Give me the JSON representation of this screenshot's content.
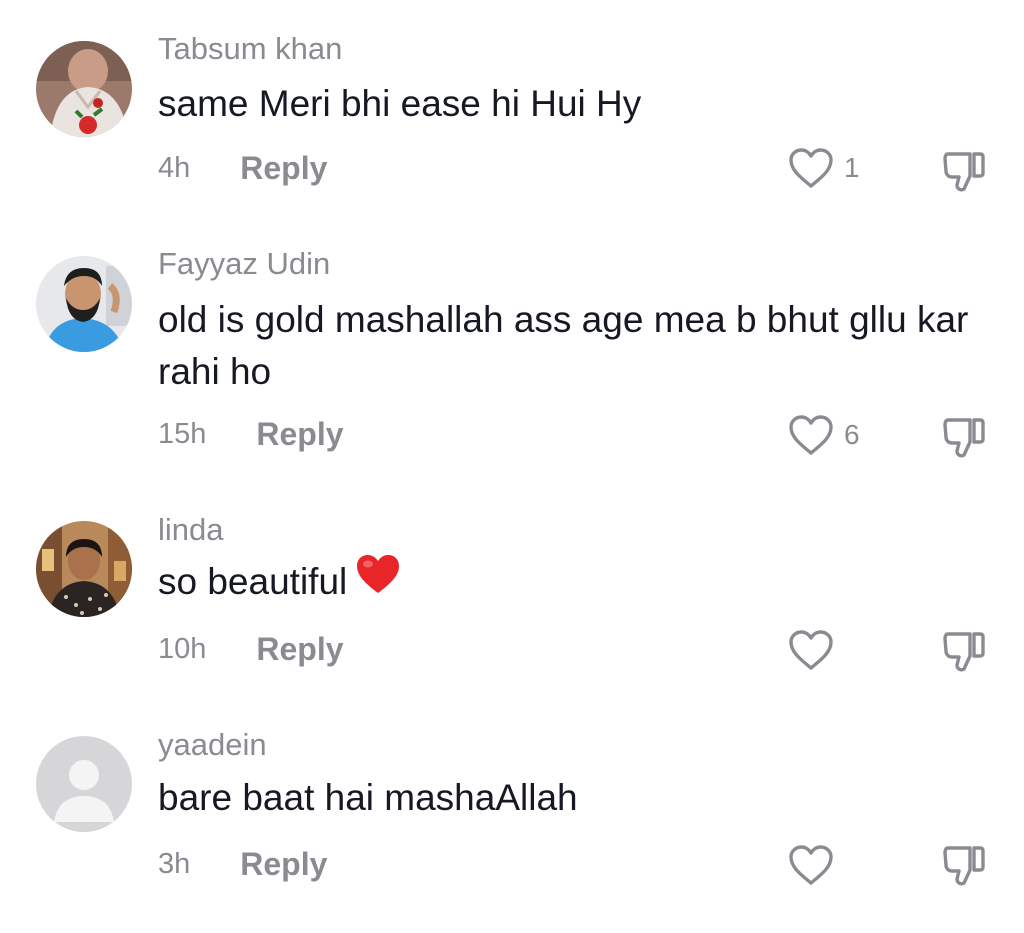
{
  "comments": [
    {
      "username": "Tabsum khan",
      "text": "same Meri bhi ease hi Hui Hy",
      "time": "4h",
      "reply_label": "Reply",
      "likes": "1",
      "emoji": ""
    },
    {
      "username": "Fayyaz Udin",
      "text": "old is gold mashallah ass age mea b bhut gllu kar rahi ho",
      "time": "15h",
      "reply_label": "Reply",
      "likes": "6",
      "emoji": ""
    },
    {
      "username": "linda",
      "text": "so beautiful",
      "time": "10h",
      "reply_label": "Reply",
      "likes": "",
      "emoji": "red-heart"
    },
    {
      "username": "yaadein",
      "text": "bare baat hai mashaAllah",
      "time": "3h",
      "reply_label": "Reply",
      "likes": "",
      "emoji": ""
    }
  ],
  "icons": {
    "like": "heart-outline-icon",
    "dislike": "thumbs-down-icon",
    "emoji": "red-heart-emoji"
  },
  "colors": {
    "text": "#161823",
    "secondary": "#8a8b91",
    "emoji_heart": "#e8262a",
    "background": "#ffffff"
  }
}
